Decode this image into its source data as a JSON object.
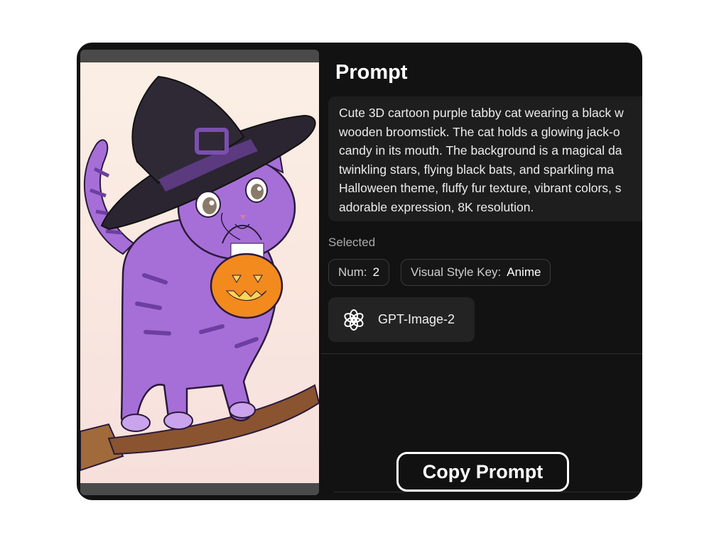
{
  "prompt": {
    "title": "Prompt",
    "text": "Cute 3D cartoon purple tabby cat wearing a black w\nwooden broomstick. The cat holds a glowing jack-o\ncandy in its mouth. The background is a magical da\ntwinkling stars, flying black bats, and sparkling ma\nHalloween theme, fluffy fur texture, vibrant colors, s\nadorable expression, 8K resolution."
  },
  "selected": {
    "label": "Selected",
    "chips": [
      {
        "key": "Num:",
        "value": "2"
      },
      {
        "key": "Visual Style Key:",
        "value": "Anime"
      }
    ]
  },
  "model": {
    "name": "GPT-Image-2",
    "icon": "openai-logo-icon"
  },
  "actions": {
    "copy_label": "Copy Prompt"
  },
  "colors": {
    "card_bg": "#121212",
    "prompt_box_bg": "#1e1e1e",
    "cat_purple": "#a66fd8",
    "hat_black": "#2a2530",
    "pumpkin_orange": "#f28a1e"
  }
}
